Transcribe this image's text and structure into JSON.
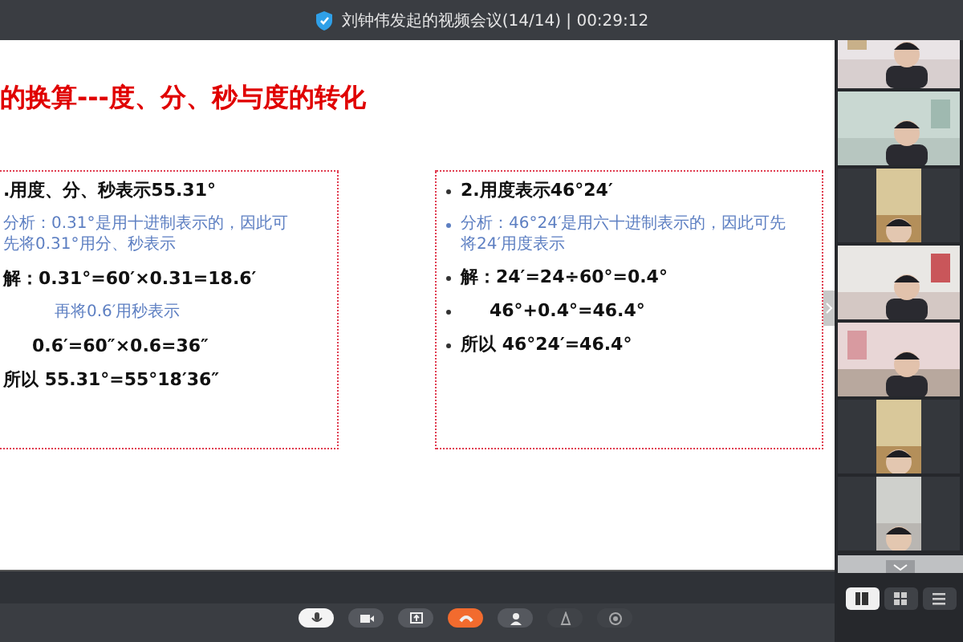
{
  "window": {
    "title": "刘钟伟发起的视频会议(14/14) | 00:29:12"
  },
  "slide": {
    "title": "的换算---度、分、秒与度的转化",
    "boxes": [
      {
        "bullets": false,
        "lines": [
          {
            "kind": "main",
            "text": ".用度、分、秒表示55.31°"
          },
          {
            "kind": "note",
            "text": "分析：0.31°是用十进制表示的，因此可"
          },
          {
            "kind": "cont",
            "text": "先将0.31°用分、秒表示"
          },
          {
            "kind": "main",
            "text": "解：0.31°=60′×0.31=18.6′"
          },
          {
            "kind": "note-indent",
            "text": "再将0.6′用秒表示"
          },
          {
            "kind": "main-indent",
            "text": "0.6′=60″×0.6=36″"
          },
          {
            "kind": "main",
            "text": "所以 55.31°=55°18′36″"
          }
        ]
      },
      {
        "bullets": true,
        "lines": [
          {
            "kind": "main",
            "text": "2.用度表示46°24′"
          },
          {
            "kind": "note",
            "text": "分析：46°24′是用六十进制表示的，因此可先将24′用度表示"
          },
          {
            "kind": "main",
            "text": "解：24′=24÷60°=0.4°"
          },
          {
            "kind": "main-indent",
            "text": "46°+0.4°=46.4°"
          },
          {
            "kind": "main",
            "text": "所以 46°24′=46.4°"
          }
        ]
      }
    ]
  },
  "participants": [
    {
      "kind": "wide"
    },
    {
      "kind": "wide"
    },
    {
      "kind": "portrait"
    },
    {
      "kind": "wide"
    },
    {
      "kind": "wide"
    },
    {
      "kind": "portrait"
    },
    {
      "kind": "portrait"
    }
  ],
  "toolbar": [
    {
      "kind": "mic",
      "active": true,
      "disabled": false
    },
    {
      "kind": "camera",
      "active": false,
      "disabled": false
    },
    {
      "kind": "share",
      "active": false,
      "disabled": false
    },
    {
      "kind": "hangup",
      "active": false,
      "disabled": false
    },
    {
      "kind": "invite",
      "active": false,
      "disabled": false
    },
    {
      "kind": "muteall",
      "active": false,
      "disabled": true
    },
    {
      "kind": "record",
      "active": false,
      "disabled": true
    }
  ],
  "views": [
    {
      "kind": "speaker",
      "selected": true
    },
    {
      "kind": "grid",
      "selected": false
    },
    {
      "kind": "list",
      "selected": false
    }
  ]
}
